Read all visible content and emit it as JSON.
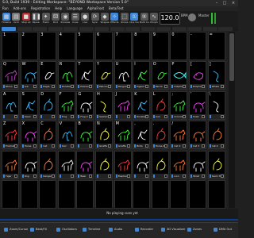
{
  "window": {
    "title": "S.0, Build 1939 - Editing Workspace: \"BEYOND Workspace Version 5.0\"",
    "controls": [
      "–",
      "□",
      "×"
    ]
  },
  "menu": [
    "Run",
    "Add-ons",
    "Registration",
    "Help",
    "Language",
    "AlphaFrost",
    "Beta/Test"
  ],
  "toolbar": {
    "buttons": [
      {
        "label": "Timeline",
        "icon": "timeline-icon",
        "color": "#3b86d9",
        "glyph": "▦"
      },
      {
        "label": "Grid",
        "icon": "grid-icon",
        "color": "#777777",
        "glyph": "▤"
      },
      {
        "label": "Stop all",
        "icon": "stop-icon",
        "color": "#b33030",
        "glyph": "■"
      },
      {
        "label": "Pause",
        "icon": "pause-icon",
        "color": "#555555",
        "glyph": "❚❚"
      },
      {
        "label": "Flash",
        "icon": "flash-icon",
        "color": "#555555",
        "glyph": "✦"
      },
      {
        "label": "Rnd",
        "icon": "random-icon",
        "color": "#555555",
        "glyph": "⚄"
      },
      {
        "label": "Preview",
        "icon": "preview-icon",
        "color": "#555555",
        "glyph": "◉"
      },
      {
        "label": "Cues",
        "icon": "cues-icon",
        "color": "#555555",
        "glyph": "☰"
      },
      {
        "label": "Live",
        "icon": "live-icon",
        "color": "#555555",
        "glyph": "●"
      },
      {
        "label": "Sync",
        "icon": "sync-icon",
        "color": "#555555",
        "glyph": "⟳"
      },
      {
        "label": "Shapes",
        "icon": "shapes-icon",
        "color": "#555555",
        "glyph": "◆"
      },
      {
        "label": "Effects",
        "icon": "effects-icon",
        "color": "#3b86d9",
        "glyph": "✧"
      },
      {
        "label": "Zones",
        "icon": "zones-icon",
        "color": "#555555",
        "glyph": "⬚"
      },
      {
        "label": "One Cue",
        "icon": "one-cue-icon",
        "color": "#3b86d9",
        "glyph": "①"
      },
      {
        "label": "Multi Cue",
        "icon": "multi-cue-icon",
        "color": "#555555",
        "glyph": "⑨"
      },
      {
        "label": "Morph",
        "icon": "morph-icon",
        "color": "#555555",
        "glyph": "∿"
      }
    ],
    "bpm_value": "120.0",
    "bpm_unit": "BPM",
    "master": "Master"
  },
  "page_tab_colors": [
    "#3b86d9",
    "#2a2a2a",
    "#2a2a2a",
    "#2a2a2a",
    "#2a2a2a",
    "#2a2a2a",
    "#2a2a2a",
    "#2a2a2a",
    "#2a2a2a",
    "#2a2a2a",
    "#2a2a2a",
    "#2a2a2a",
    "#2a2a2a",
    "#2a2a2a",
    "#2a2a2a"
  ],
  "grid": {
    "rows": [
      {
        "keys": [
          "1",
          "2",
          "3",
          "4",
          "5",
          "6",
          "7",
          "8",
          "9",
          "0",
          "-",
          "="
        ],
        "labels": [
          "",
          "",
          "",
          "",
          "",
          "",
          "",
          "",
          "",
          "",
          "",
          ""
        ],
        "colors": [
          "#000",
          "#000",
          "#000",
          "#000",
          "#000",
          "#000",
          "#000",
          "#000",
          "#000",
          "#000",
          "#000",
          "#000"
        ],
        "kinds": [
          "",
          "",
          "",
          "",
          "",
          "",
          "",
          "",
          "",
          "",
          "",
          ""
        ]
      },
      {
        "keys": [
          "Q",
          "W",
          "E",
          "R",
          "T",
          "Y",
          "U",
          "I",
          "O",
          "P",
          "[",
          "]"
        ],
        "labels": [
          "Rhino",
          "Ant",
          "Eagle",
          "Rooster",
          "Pelican",
          "Pelican 2",
          "Penguin",
          "Pigeon",
          "Parrot",
          "Dolphin",
          "Dolphin 2",
          "Whale"
        ],
        "colors": [
          "#d040d0",
          "#40c0ff",
          "#ffffff",
          "#40ff40",
          "#ffffff",
          "#ffff40",
          "#ffffff",
          "#40ff40",
          "#40ff40",
          "#40ffff",
          "#ff40ff",
          "#40c0ff"
        ],
        "kinds": [
          "beast",
          "beast",
          "bird",
          "bird",
          "bird",
          "bird",
          "bird",
          "bird",
          "bird",
          "fish",
          "fish",
          "fish"
        ]
      },
      {
        "keys": [
          "A",
          "S",
          "D",
          "F",
          "G",
          "H",
          "J",
          "K",
          "L",
          ";",
          "'",
          "\\"
        ],
        "labels": [
          "",
          "Swan",
          "",
          "Frog",
          "Frog 2",
          "Seahorse",
          "",
          "Rooster",
          "Lion",
          "Crocodile",
          "Snail",
          ""
        ],
        "colors": [
          "#40c0ff",
          "#40c0ff",
          "#40c0ff",
          "#40ff40",
          "#ffffff",
          "#ffff40",
          "#ff40ff",
          "#40c0ff",
          "#ff4040",
          "#40ff40",
          "#ff40ff",
          "#ffffff"
        ],
        "kinds": [
          "bird",
          "bird",
          "beast",
          "beast",
          "beast",
          "fish",
          "beast",
          "bird",
          "beast",
          "beast",
          "beast",
          "fish"
        ]
      },
      {
        "keys": [
          "Z",
          "X",
          "C",
          "V",
          "B",
          "N",
          "M",
          ",",
          ".",
          "/",
          "",
          ""
        ],
        "labels": [
          "Fox/Cat/a",
          "Horse",
          "Cat",
          "Owl",
          "",
          "Giraffe",
          "Giraffe 2",
          "Birds",
          "Horse 4",
          "Cat 2",
          "Cat 3",
          "Cat 4"
        ],
        "colors": [
          "#ff4040",
          "#ff40ff",
          "#ff8040",
          "#40c0ff",
          "#40ff40",
          "#ffff40",
          "#40ff40",
          "#ffffff",
          "#ff4040",
          "#ff8040",
          "#ff8040",
          "#ff8040"
        ],
        "kinds": [
          "beast",
          "beast",
          "beast",
          "bird",
          "beast",
          "beast",
          "beast",
          "bird",
          "beast",
          "beast",
          "beast",
          "beast"
        ]
      },
      {
        "keys": [
          "",
          "",
          "",
          "",
          "",
          "",
          "",
          "",
          "",
          "",
          "",
          ""
        ],
        "labels": [
          "Tiger",
          "Dog",
          "Kangaroo",
          "",
          "Bear",
          "",
          "Elephant",
          "",
          "",
          "Lion",
          "Stoat",
          "Swim Tiger"
        ],
        "colors": [
          "#ff8040",
          "#ffffff",
          "#ff8040",
          "#ffffff",
          "#ff40ff",
          "#ffff40",
          "#ff4040",
          "#ffffff",
          "#ffff40",
          "#ff8040",
          "#ffffff",
          "#ffff40"
        ],
        "kinds": [
          "beast",
          "beast",
          "beast",
          "beast",
          "beast",
          "beast",
          "beast",
          "beast",
          "beast",
          "beast",
          "beast",
          "beast"
        ]
      },
      {
        "keys": [
          "",
          "",
          "",
          "",
          "",
          "",
          "",
          "",
          "",
          "",
          "",
          ""
        ],
        "labels": [
          "",
          "",
          "",
          "",
          "",
          "",
          "",
          "",
          "",
          "",
          "",
          ""
        ],
        "colors": [
          "#000",
          "#000",
          "#000",
          "#000",
          "#000",
          "#000",
          "#000",
          "#000",
          "#000",
          "#000",
          "#000",
          "#000"
        ],
        "kinds": [
          "",
          "",
          "",
          "",
          "",
          "",
          "",
          "",
          "",
          "",
          "",
          ""
        ]
      }
    ]
  },
  "status": {
    "text": "No playing cues yet"
  },
  "taskbar": [
    {
      "label": "Zoom/Cursor",
      "icon": "cursor-icon",
      "color": "#3b86d9"
    },
    {
      "label": "Beat/FX",
      "icon": "beat-icon",
      "color": "#3b86d9"
    },
    {
      "label": "Oscillators",
      "icon": "oscillator-icon",
      "color": "#3b86d9"
    },
    {
      "label": "Timeline",
      "icon": "timeline-icon",
      "color": "#3b86d9"
    },
    {
      "label": "Audio",
      "icon": "audio-icon",
      "color": "#3b86d9"
    },
    {
      "label": "Recorder",
      "icon": "recorder-icon",
      "color": "#3b86d9"
    },
    {
      "label": "3D Visualizer",
      "icon": "visualizer-icon",
      "color": "#3b86d9"
    },
    {
      "label": "Zones",
      "icon": "zones-icon",
      "color": "#3b86d9"
    },
    {
      "label": "DMX Out",
      "icon": "dmx-icon",
      "color": "#3b86d9"
    }
  ]
}
